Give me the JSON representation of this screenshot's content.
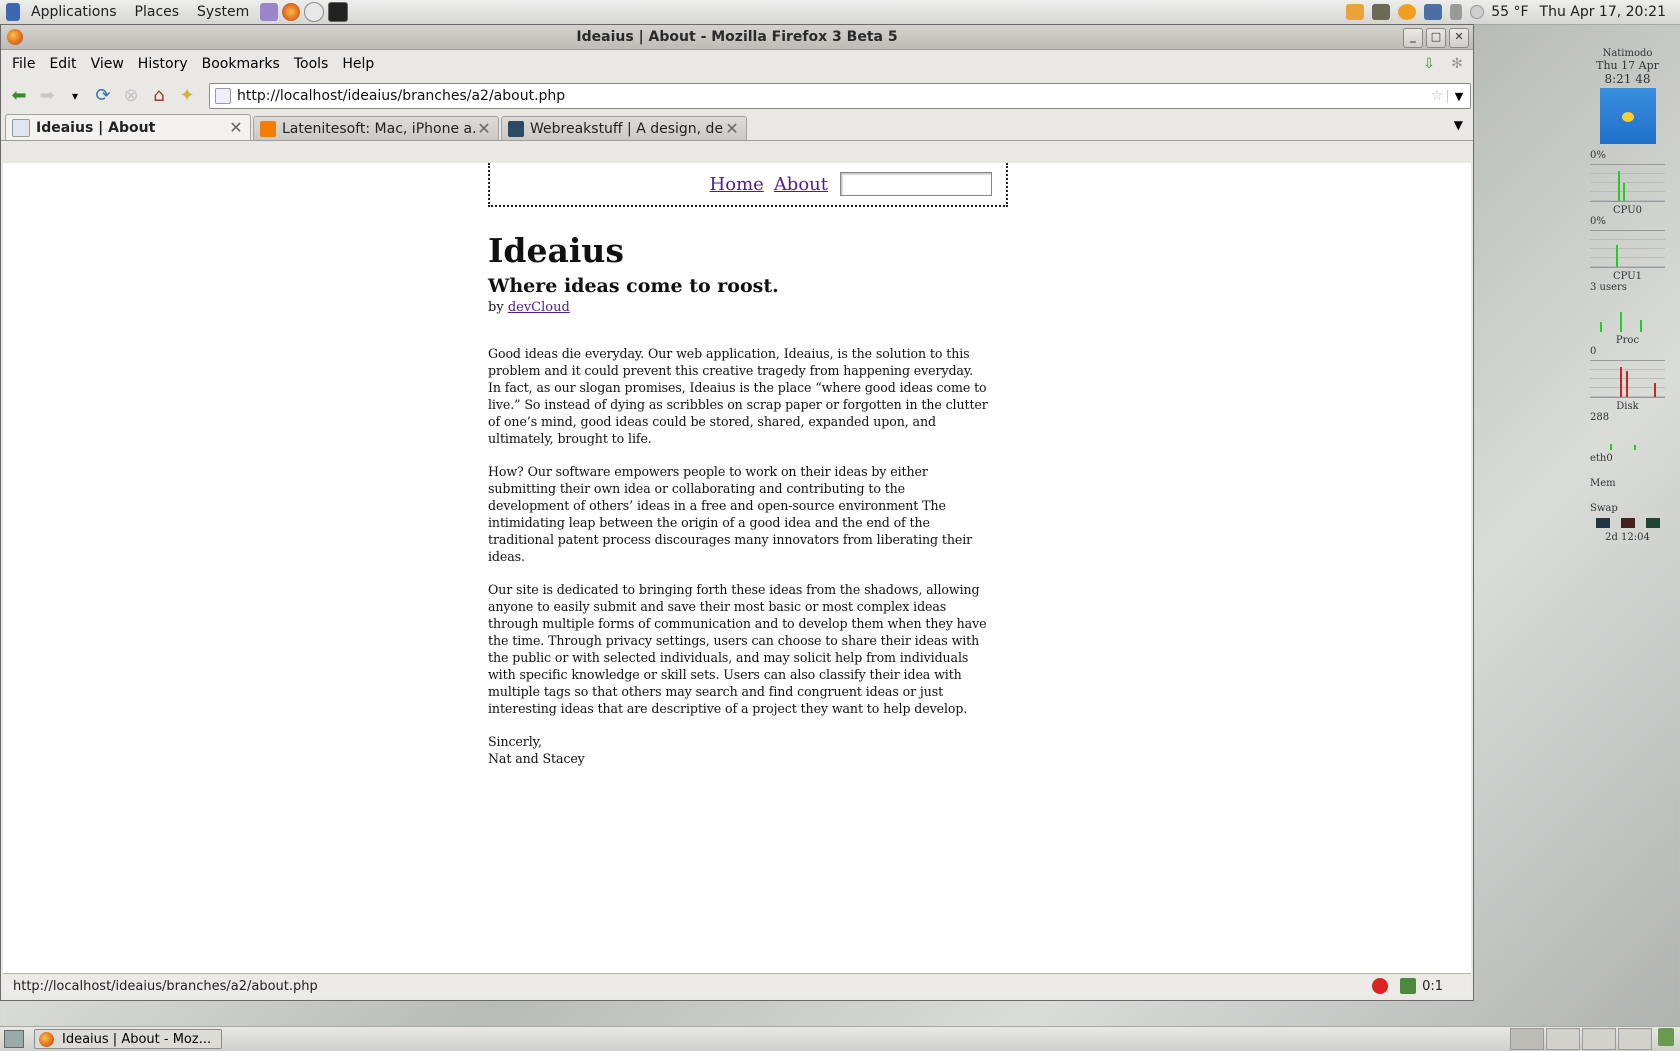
{
  "top_panel": {
    "menus": [
      "Applications",
      "Places",
      "System"
    ],
    "launchers": [
      "pidgin-icon",
      "firefox-icon",
      "mail-icon",
      "terminal-icon"
    ],
    "weather": "55 °F",
    "clock": "Thu Apr 17, 20:21"
  },
  "window": {
    "title": "Ideaius | About - Mozilla Firefox 3 Beta 5",
    "menu": [
      "File",
      "Edit",
      "View",
      "History",
      "Bookmarks",
      "Tools",
      "Help"
    ],
    "url": "http://localhost/ideaius/branches/a2/about.php",
    "tabs": [
      {
        "label": "Ideaius | About",
        "active": true,
        "icon_color": "#dfe6ef"
      },
      {
        "label": "Latenitesoft: Mac, iPhone a...",
        "active": false,
        "icon_color": "#f57d00"
      },
      {
        "label": "Webreakstuff | A design, de...",
        "active": false,
        "icon_color": "#2c4a63"
      }
    ],
    "status_url": "http://localhost/ideaius/branches/a2/about.php",
    "status_counter": "0:1"
  },
  "site": {
    "nav": {
      "home": "Home",
      "about": "About",
      "search_value": ""
    },
    "title": "Ideaius",
    "slogan": "Where ideas come to roost.",
    "by_prefix": "by",
    "author": "devCloud",
    "paragraphs": [
      "Good ideas die everyday. Our web application, Ideaius, is the solution to this problem and it could prevent this creative tragedy from happening everyday. In fact, as our slogan promises, Ideaius is the place “where good ideas come to live.” So instead of dying as scribbles on scrap paper or forgotten in the clutter of one’s mind, good ideas could be stored, shared, expanded upon, and ultimately, brought to life.",
      "How? Our software empowers people to work on their ideas by either submitting their own idea or collaborating and contributing to the development of others’ ideas in a free and open-source environment The intimidating leap between the origin of a good idea and the end of the traditional patent process discourages many innovators from liberating their ideas.",
      "Our site is dedicated to bringing forth these ideas from the shadows, allowing anyone to easily submit and save their most basic or most complex ideas through multiple forms of communication and to develop them when they have the time. Through privacy settings, users can choose to share their ideas with the public or with selected individuals, and may solicit help from individuals with specific knowledge or skill sets. Users can also classify their idea with multiple tags so that others may search and find congruent ideas or just interesting ideas that are descriptive of a project they want to help develop."
    ],
    "closing": "Sincerly,",
    "signature": "Nat and Stacey"
  },
  "desklet": {
    "name": "Natimodo",
    "date": "Thu 17 Apr",
    "time": "8:21 48",
    "labels": [
      "0%",
      "CPU0",
      "0%",
      "CPU1",
      "3 users",
      "Proc",
      "0",
      "Disk",
      "288",
      "eth0",
      "Mem",
      "Swap"
    ],
    "uptime": "2d 12:04"
  },
  "bottom_panel": {
    "task": "Ideaius | About - Moz..."
  }
}
